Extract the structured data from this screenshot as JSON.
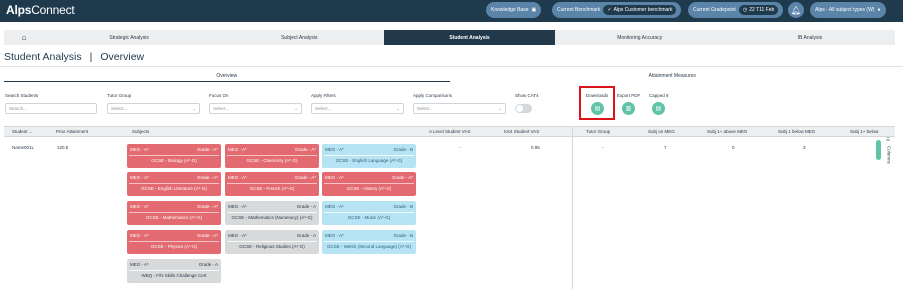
{
  "app": {
    "logo_bold": "Alps",
    "logo_rest": "Connect"
  },
  "topbar": {
    "knowledge_base": "Knowledge Base",
    "benchmark_label": "Current Benchmark",
    "benchmark_value": "Alps Customer benchmark",
    "gradepoint_label": "Current Gradepoint",
    "gradepoint_value": "22 T11 Feb",
    "user_label": "Alps - All subject types (W)"
  },
  "nav": {
    "tabs": [
      "Strategic Analysis",
      "Subject Analysis",
      "Student Analysis",
      "Monitoring Accuracy",
      "IB Analysis"
    ],
    "active": "Student Analysis"
  },
  "page": {
    "title": "Student Analysis",
    "subtitle": "Overview"
  },
  "subtabs": [
    "Overview",
    "Attainment Measures"
  ],
  "filters": {
    "search_label": "Search Students",
    "search_placeholder": "Search...",
    "tutor_label": "Tutor Group",
    "focus_label": "Focus On",
    "apply_filters_label": "Apply Filters",
    "apply_comparisons_label": "Apply Comparisons",
    "select_placeholder": "Select...",
    "show_cat4_label": "Show CAT4",
    "downloads_label": "Downloads",
    "export_pdf_label": "Export PDF",
    "capped_label": "Capped 8"
  },
  "table": {
    "headers": [
      "Student ...",
      "Prior Attainment",
      "Subjects",
      "A Level Student VAS",
      "KS4 Student VAS",
      "Tutor Group",
      "Subj on MEG",
      "Subj 1+ above MEG",
      "Subj 1 below MEG",
      "Subj 1+ below"
    ],
    "row": {
      "student": "Name001L",
      "prior": "120.5",
      "a_level_vas": "-",
      "ks4_vas": "0.95",
      "tutor": "-",
      "on_meg": "7",
      "above_meg": "0",
      "below1_meg": "3",
      "below_more": ""
    },
    "columns_label": "Columns"
  },
  "subjects": [
    {
      "meg": "MEG - A*",
      "grade": "Grade - A*",
      "name": "GCSE - Biology (A*-G)",
      "status": "red"
    },
    {
      "meg": "MEG - A*",
      "grade": "Grade - A*",
      "name": "GCSE - Chemistry (A*-G)",
      "status": "red"
    },
    {
      "meg": "MEG - A*",
      "grade": "Grade - B",
      "name": "GCSE - English Language (A*-G)",
      "status": "blue"
    },
    {
      "meg": "MEG - A*",
      "grade": "Grade - A*",
      "name": "GCSE - English Literature (A*-G)",
      "status": "red"
    },
    {
      "meg": "MEG - A*",
      "grade": "Grade - A*",
      "name": "GCSE - French (A*-G)",
      "status": "red"
    },
    {
      "meg": "MEG - A*",
      "grade": "Grade - A*",
      "name": "GCSE - History (A*-G)",
      "status": "red"
    },
    {
      "meg": "MEG - A*",
      "grade": "Grade - A*",
      "name": "GCSE - Mathematics (A*-G)",
      "status": "red"
    },
    {
      "meg": "MEG - A*",
      "grade": "Grade - A",
      "name": "GCSE - Mathematics (Numeracy) (A*-G)",
      "status": "gray"
    },
    {
      "meg": "MEG - A*",
      "grade": "Grade - B",
      "name": "GCSE - Music (A*-G)",
      "status": "blue"
    },
    {
      "meg": "MEG - A*",
      "grade": "Grade - A*",
      "name": "GCSE - Physics (A*-G)",
      "status": "red"
    },
    {
      "meg": "MEG - A*",
      "grade": "Grade - A",
      "name": "GCSE - Religious Studies (A*-G)",
      "status": "gray"
    },
    {
      "meg": "MEG - A*",
      "grade": "Grade - B",
      "name": "GCSE - Welsh (Second Language) (A*-G)",
      "status": "blue"
    },
    {
      "meg": "MEG - A*",
      "grade": "Grade - A",
      "name": "WBQ - F/N Skills Challenge Cert",
      "status": "gray"
    }
  ],
  "colors": {
    "brand": "#1f3a4d",
    "accent": "#5fc4a8",
    "above": "#e26a70",
    "on": "#d7d9db",
    "below": "#b7e4f5"
  }
}
